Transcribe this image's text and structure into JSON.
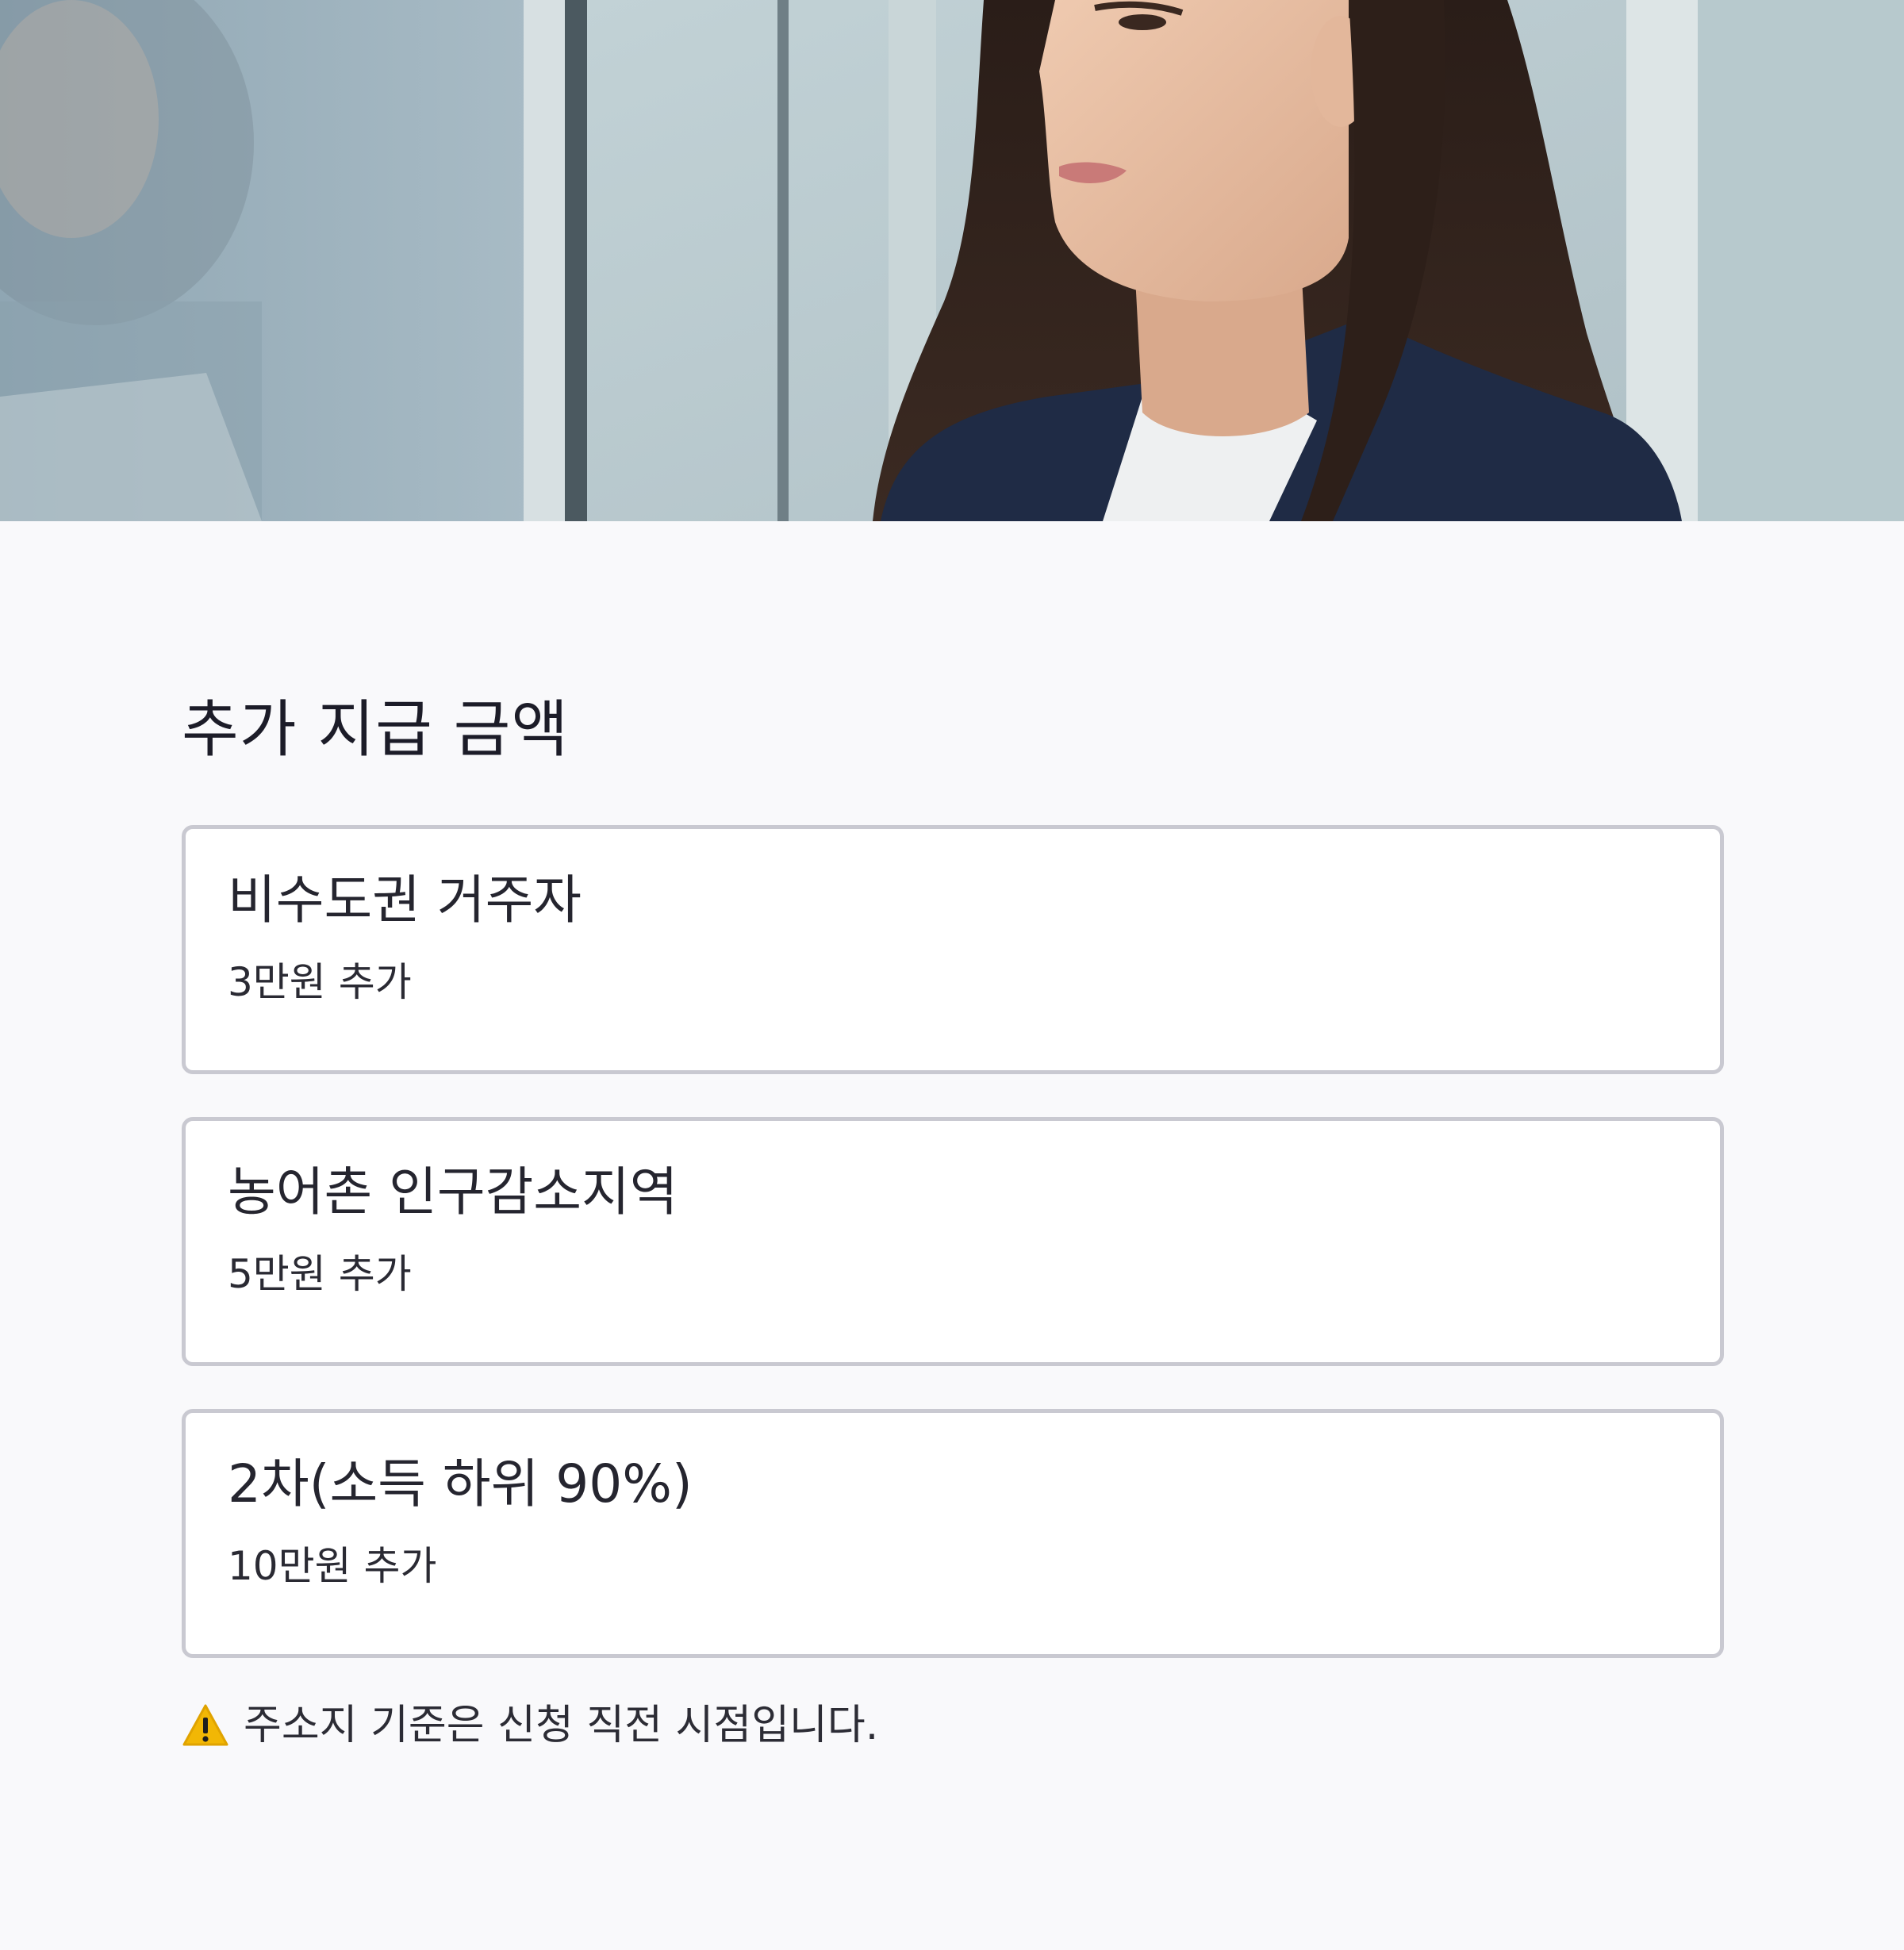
{
  "hero": {
    "image": "businesswoman-window-photo"
  },
  "section": {
    "title": "추가 지급 금액"
  },
  "cards": [
    {
      "title": "비수도권 거주자",
      "description": "3만원 추가"
    },
    {
      "title": "농어촌 인구감소지역",
      "description": "5만원 추가"
    },
    {
      "title": "2차(소득 하위 90%)",
      "description": "10만원 추가"
    }
  ],
  "notice": {
    "icon": "warning-icon",
    "text": "주소지 기준은 신청 직전 시점입니다."
  },
  "colors": {
    "background": "#f9f9fb",
    "card_border": "#c9c9d1",
    "text": "#25252f",
    "warning": "#f2b705"
  }
}
